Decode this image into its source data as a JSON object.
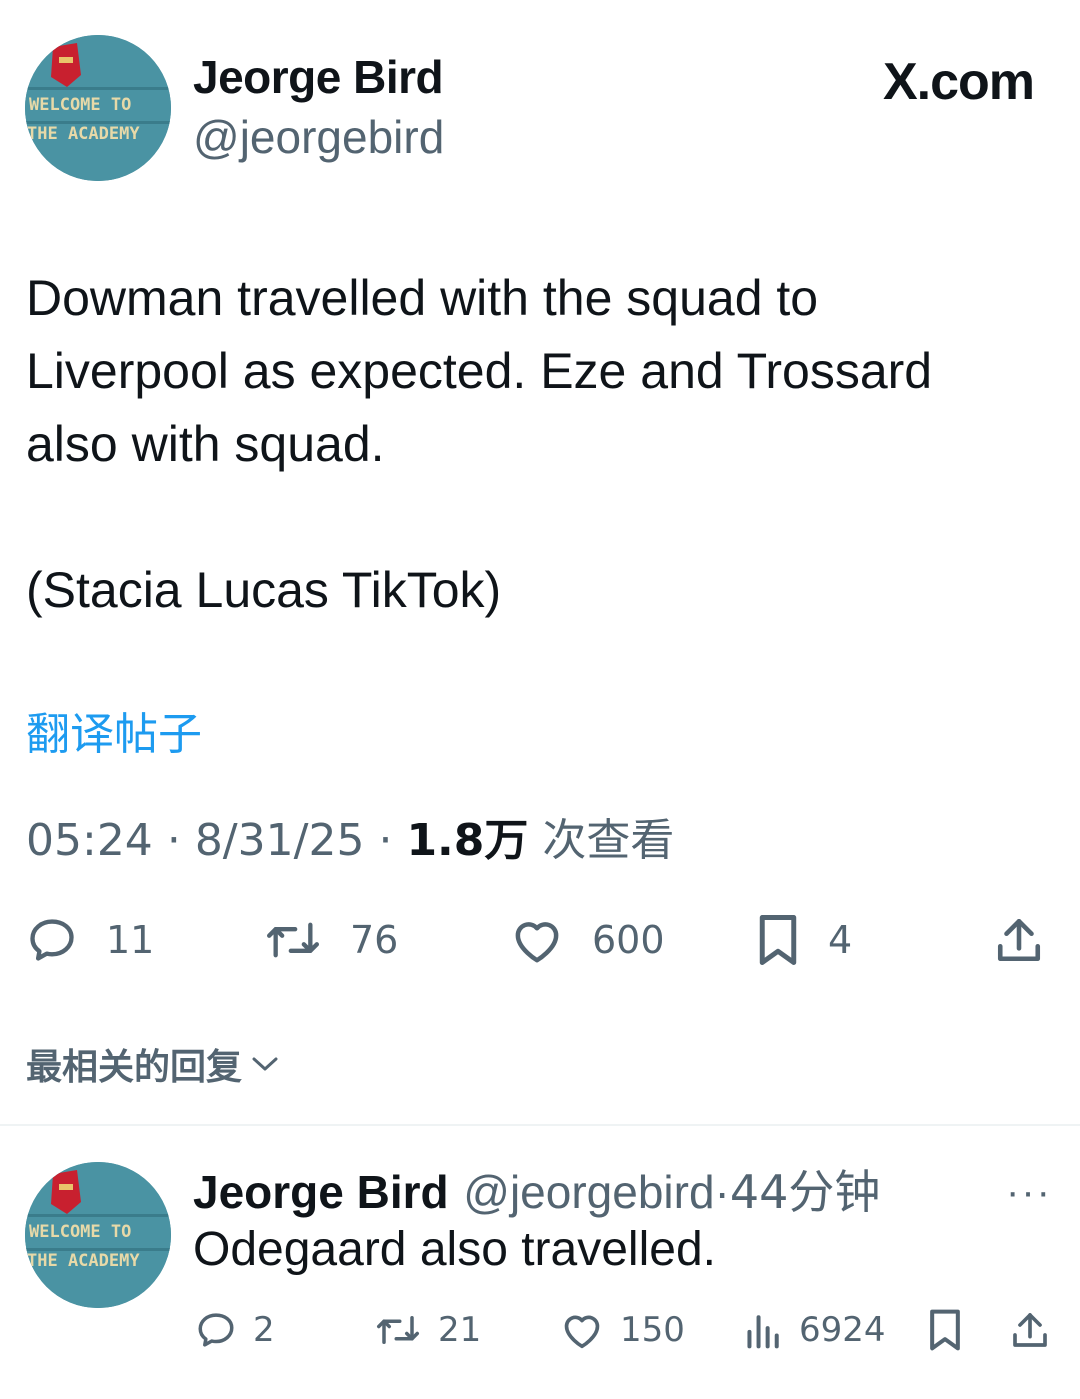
{
  "tweet": {
    "author_name": "Jeorge Bird",
    "author_handle": "@jeorgebird",
    "site_label": "X.com",
    "text": "Dowman travelled with the squad to\nLiverpool as expected. Eze and Trossard\nalso with squad.\n\n(Stacia Lucas TikTok)",
    "translate_label": "翻译帖子",
    "time": "05:24",
    "date": "8/31/25",
    "views": "1.8万",
    "views_label": "次查看",
    "separator": "·",
    "stats": {
      "replies": "11",
      "reposts": "76",
      "likes": "600",
      "bookmarks": "4"
    },
    "avatar_text": [
      "WELCOME TO",
      "THE ACADEMY"
    ]
  },
  "sort_label": "最相关的回复",
  "reply": {
    "author_name": "Jeorge Bird",
    "author_handle": "@jeorgebird",
    "separator": "·",
    "time_ago": "44分钟",
    "more_label": "···",
    "text": "Odegaard also travelled.",
    "stats": {
      "replies": "2",
      "reposts": "21",
      "likes": "150",
      "views": "6924"
    }
  },
  "colors": {
    "text": "#0f1419",
    "secondary": "#536471",
    "link": "#1d9bf0",
    "divider": "#eff3f4"
  }
}
